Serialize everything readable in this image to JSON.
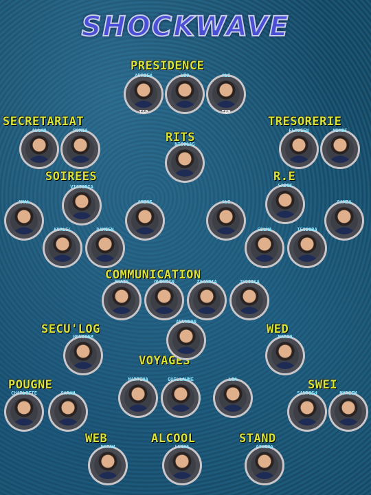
{
  "title": "SHOCKWAVE",
  "groups": {
    "presidence": "PRESIDENCE",
    "secretariat": "SECRETARIAT",
    "rits": "RITS",
    "tresorerie": "TRESORERIE",
    "soirees": "SOIREES",
    "re": "R.E",
    "communication": "COMMUNICATION",
    "seculog": "SECU'LOG",
    "wed": "WED",
    "voyages": "VOYAGES",
    "pougne": "POUGNE",
    "swei": "SWEI",
    "web": "WEB",
    "alcool": "ALCOOL",
    "stand": "STAND"
  },
  "members": [
    {
      "name": "ADRIEN",
      "sub": "TSP"
    },
    {
      "name": "LÉO",
      "sub": ""
    },
    {
      "name": "ALI",
      "sub": "TEM"
    },
    {
      "name": "ALLAN",
      "sub": ""
    },
    {
      "name": "ROMIA",
      "sub": ""
    },
    {
      "name": "NICOLAS",
      "sub": ""
    },
    {
      "name": "FLAVIEN",
      "sub": ""
    },
    {
      "name": "MEHDI",
      "sub": ""
    },
    {
      "name": "VICTORIA",
      "sub": ""
    },
    {
      "name": "AMAL",
      "sub": ""
    },
    {
      "name": "AMINE",
      "sub": ""
    },
    {
      "name": "KHALIL",
      "sub": ""
    },
    {
      "name": "DAMIEN",
      "sub": ""
    },
    {
      "name": "SADOK",
      "sub": ""
    },
    {
      "name": "ALI",
      "sub": ""
    },
    {
      "name": "SAMIA",
      "sub": ""
    },
    {
      "name": "SELMA",
      "sub": ""
    },
    {
      "name": "TEODORA",
      "sub": ""
    },
    {
      "name": "ANAIS",
      "sub": ""
    },
    {
      "name": "QUENTIN",
      "sub": ""
    },
    {
      "name": "ZAKARIA",
      "sub": ""
    },
    {
      "name": "JESSICA",
      "sub": ""
    },
    {
      "name": "ARUNSON",
      "sub": ""
    },
    {
      "name": "HOUSSEM",
      "sub": ""
    },
    {
      "name": "MARIN",
      "sub": ""
    },
    {
      "name": "MARTINA",
      "sub": ""
    },
    {
      "name": "GUILLAUME",
      "sub": ""
    },
    {
      "name": "LEA",
      "sub": ""
    },
    {
      "name": "CHARLOTTE",
      "sub": ""
    },
    {
      "name": "SARAH",
      "sub": ""
    },
    {
      "name": "SANTOSH",
      "sub": ""
    },
    {
      "name": "MYRIEM",
      "sub": ""
    },
    {
      "name": "NATAN",
      "sub": ""
    },
    {
      "name": "LUCAS",
      "sub": ""
    },
    {
      "name": "ATHINA",
      "sub": ""
    }
  ]
}
